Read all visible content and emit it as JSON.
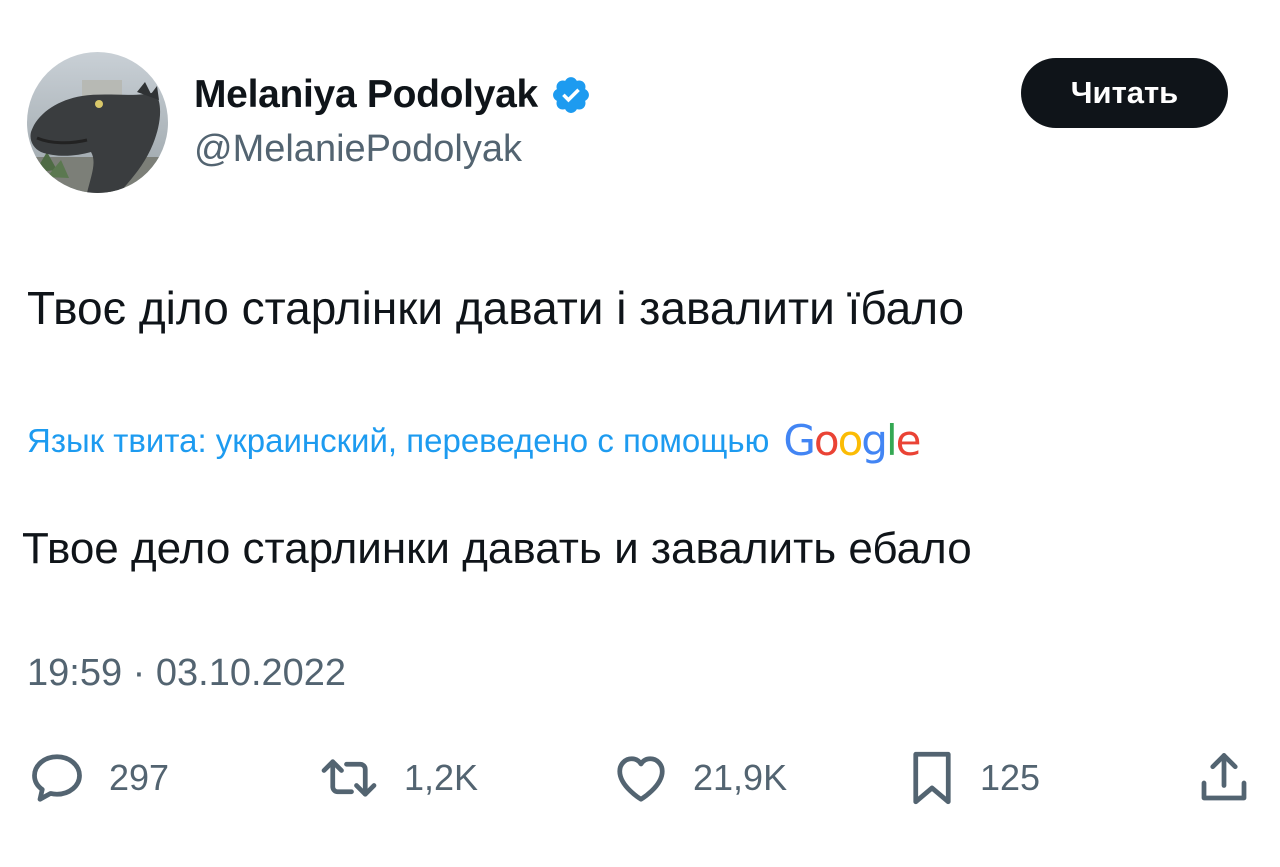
{
  "author": {
    "display_name": "Melaniya Podolyak",
    "handle": "@MelaniePodolyak",
    "verified": true
  },
  "follow_button": {
    "label": "Читать"
  },
  "tweet": {
    "text": "Твоє діло старлінки давати і завалити їбало",
    "translation_label": "Язык твита: украинский, переведено с помощью",
    "translation_provider_logo": "Google",
    "translated_text": "Твое дело старлинки давать и завалить ебало",
    "timestamp": "19:59 · 03.10.2022"
  },
  "actions": {
    "replies": "297",
    "retweets": "1,2K",
    "likes": "21,9K",
    "bookmarks": "125"
  },
  "icons": {
    "reply": "speech-bubble-icon",
    "retweet": "retweet-arrows-icon",
    "like": "heart-icon",
    "bookmark": "bookmark-icon",
    "share": "share-upload-icon",
    "verified": "verified-badge-icon"
  },
  "colors": {
    "text_primary": "#0f1419",
    "text_secondary": "#536471",
    "link_blue": "#1d9bf0",
    "verified_blue": "#1d9bf0",
    "follow_button_bg": "#0f1419",
    "google_blue": "#4285F4",
    "google_red": "#EA4335",
    "google_yellow": "#FBBC05",
    "google_green": "#34A853"
  }
}
